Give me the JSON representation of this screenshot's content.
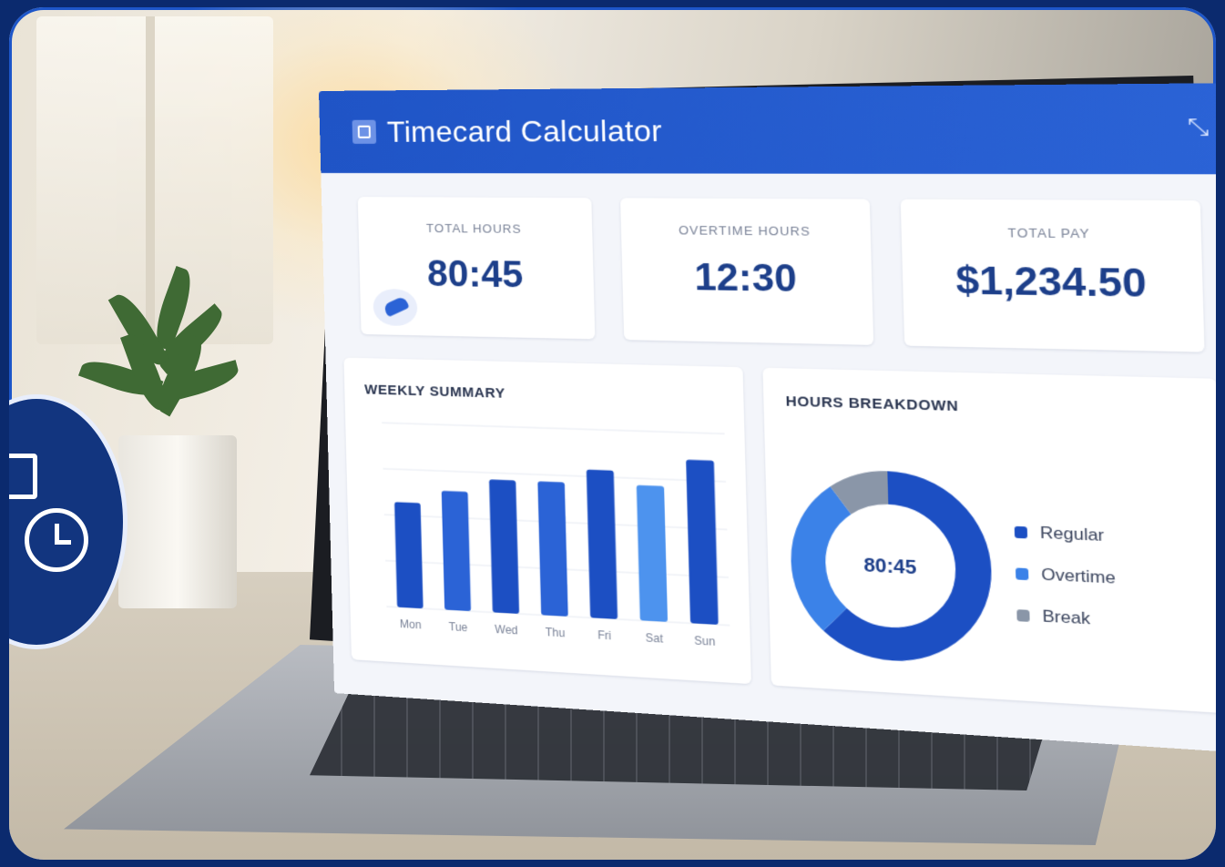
{
  "app": {
    "title": "Timecard Calculator"
  },
  "stats": [
    {
      "label": "TOTAL HOURS",
      "value": "80:45"
    },
    {
      "label": "OVERTIME HOURS",
      "value": "12:30"
    },
    {
      "label": "TOTAL PAY",
      "value": "$1,234.50"
    }
  ],
  "weekly_summary": {
    "title": "WEEKLY SUMMARY"
  },
  "hours_breakdown": {
    "title": "HOURS BREAKDOWN",
    "center_value": "80:45",
    "legend": [
      "Regular",
      "Overtime",
      "Break"
    ]
  },
  "colors": {
    "header": "#1f54c6",
    "accent": "#2b63d6",
    "regular": "#1c4fc3",
    "overtime": "#3b82e8",
    "break": "#8a96a8"
  },
  "icons": {
    "header_right": "resize-icon",
    "app_logo": "calculator-icon",
    "badge": "timesheet-clock-icon"
  },
  "chart_data": [
    {
      "type": "bar",
      "title": "WEEKLY SUMMARY",
      "categories": [
        "Mon",
        "Tue",
        "Wed",
        "Thu",
        "Fri",
        "Sat",
        "Sun"
      ],
      "values": [
        8,
        9,
        10,
        10,
        11,
        10,
        12
      ],
      "ylim": [
        0,
        14
      ]
    },
    {
      "type": "pie",
      "title": "HOURS BREAKDOWN",
      "categories": [
        "Regular",
        "Overtime",
        "Break"
      ],
      "values": [
        62,
        28,
        10
      ]
    }
  ]
}
